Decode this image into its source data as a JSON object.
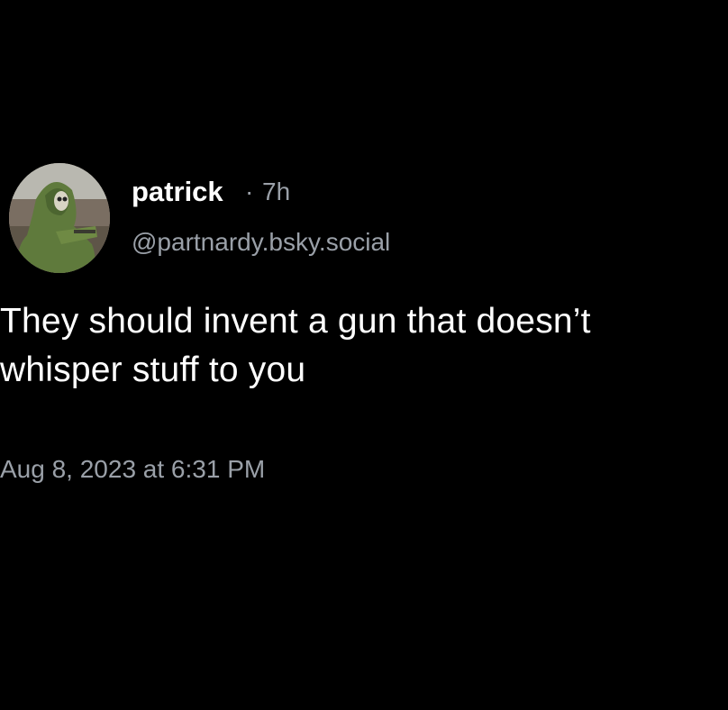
{
  "author": {
    "display_name": "patrick",
    "separator": "·",
    "relative_time": "7h",
    "handle": "@partnardy.bsky.social",
    "avatar_icon": "profile-photo-icon"
  },
  "post": {
    "text_line1": "They should invent a gun that doesn’t",
    "text_line2": "whisper stuff to you",
    "timestamp": "Aug 8, 2023 at 6:31 PM"
  },
  "colors": {
    "background": "#000000",
    "text_primary": "#ffffff",
    "text_secondary": "#9aa0a8"
  }
}
